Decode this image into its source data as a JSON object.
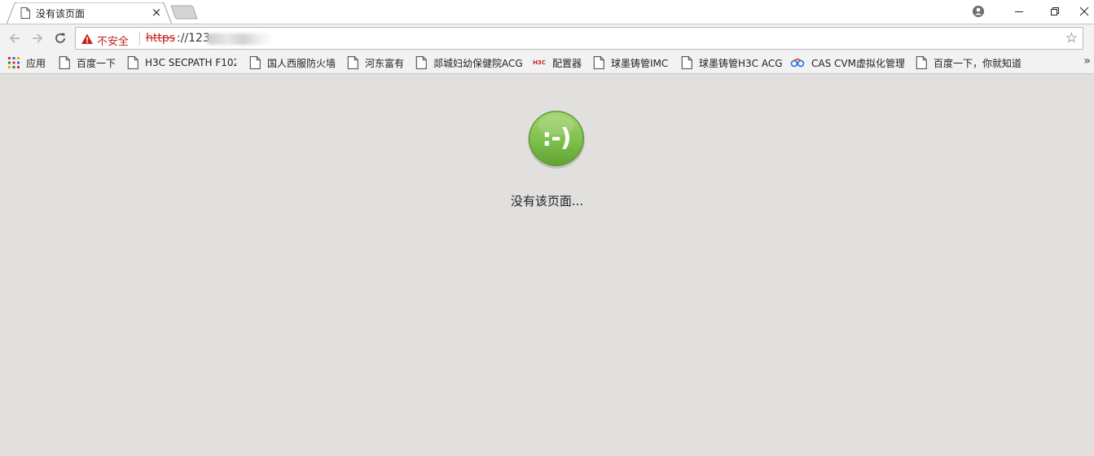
{
  "tab": {
    "title": "没有该页面",
    "close_glyph": "×"
  },
  "window": {
    "minimize_glyph": "—",
    "restore_glyph": "❐",
    "close_glyph": "✕"
  },
  "toolbar": {
    "security_label": "不安全",
    "url_scheme": "https",
    "url_rest": "://123.",
    "star_glyph": "☆"
  },
  "bookmarks": {
    "items": [
      {
        "label": "应用",
        "icon": "apps-grid-icon"
      },
      {
        "label": "百度一下",
        "icon": "page-icon"
      },
      {
        "label": "H3C SECPATH F102",
        "icon": "page-icon"
      },
      {
        "label": "国人西服防火墙",
        "icon": "page-icon"
      },
      {
        "label": "河东富有",
        "icon": "page-icon"
      },
      {
        "label": "郯城妇幼保健院ACG",
        "icon": "page-icon"
      },
      {
        "label": "配置器",
        "icon": "h3c-logo-icon"
      },
      {
        "label": "球墨铸管IMC",
        "icon": "page-icon"
      },
      {
        "label": "球墨铸管H3C ACG",
        "icon": "page-icon"
      },
      {
        "label": "CAS CVM虚拟化管理",
        "icon": "cas-logo-icon"
      },
      {
        "label": "百度一下，你就知道",
        "icon": "page-icon"
      }
    ],
    "more_glyph": "»",
    "h3c_logo_text": "H3C"
  },
  "page": {
    "smiley": ":-)",
    "message": "没有该页面..."
  },
  "colors": {
    "background": "#e1e0df",
    "smiley_green": "#7fbf4d",
    "insecure_red": "#c5221f"
  }
}
